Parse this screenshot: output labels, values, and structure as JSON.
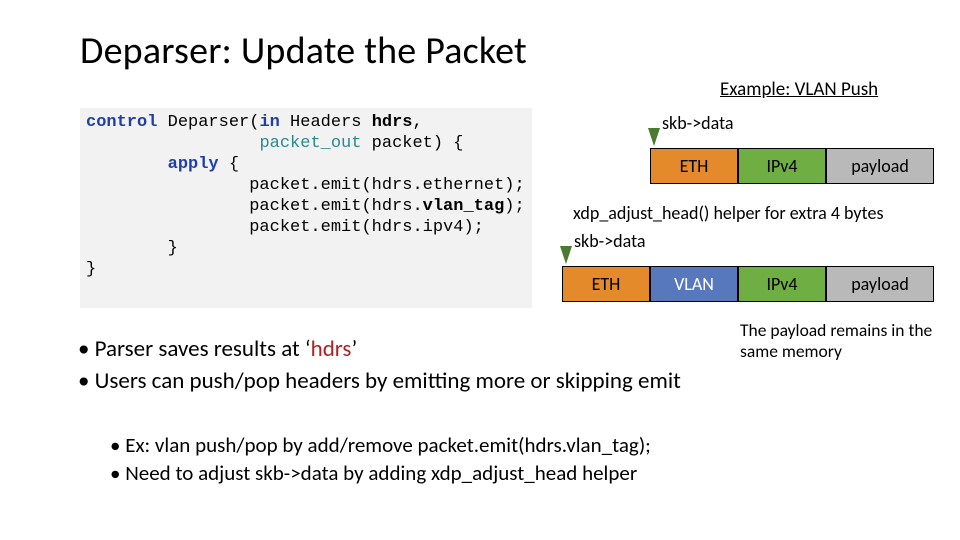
{
  "title": "Deparser: Update the Packet",
  "example_heading": "Example: VLAN Push",
  "skb_label_1": "skb->data",
  "skb_label_2": "skb->data",
  "xdp_helper_text": "xdp_adjust_head() helper for extra 4 bytes",
  "payload_note": "The payload remains in the same memory",
  "row1": {
    "eth": "ETH",
    "ipv4": "IPv4",
    "payload": "payload"
  },
  "row2": {
    "eth": "ETH",
    "vlan": "VLAN",
    "ipv4": "IPv4",
    "payload": "payload"
  },
  "code": {
    "l1a": "control",
    "l1b": " Deparser(",
    "l1c": "in",
    "l1d": " Headers ",
    "l1e": "hdrs",
    "l1f": ",",
    "l2a": "                 ",
    "l2b": "packet_out",
    "l2c": " packet) {",
    "l3a": "        ",
    "l3b": "apply",
    "l3c": " {",
    "l4": "                packet.emit(hdrs.ethernet);",
    "l5a": "                packet.emit(hdrs.",
    "l5b": "vlan_tag",
    "l5c": ");",
    "l6": "                packet.emit(hdrs.ipv4);",
    "l7": "        }",
    "l8": "}"
  },
  "bullet1_prefix": "• Parser saves results at ‘",
  "bullet1_hdrs": "hdrs",
  "bullet1_suffix": "’",
  "bullet2": "• Users can push/pop headers by emitting more or skipping emit",
  "sub1": "• Ex: vlan push/pop by add/remove packet.emit(hdrs.vlan_tag);",
  "sub2": "• Need to adjust skb->data by adding xdp_adjust_head helper"
}
